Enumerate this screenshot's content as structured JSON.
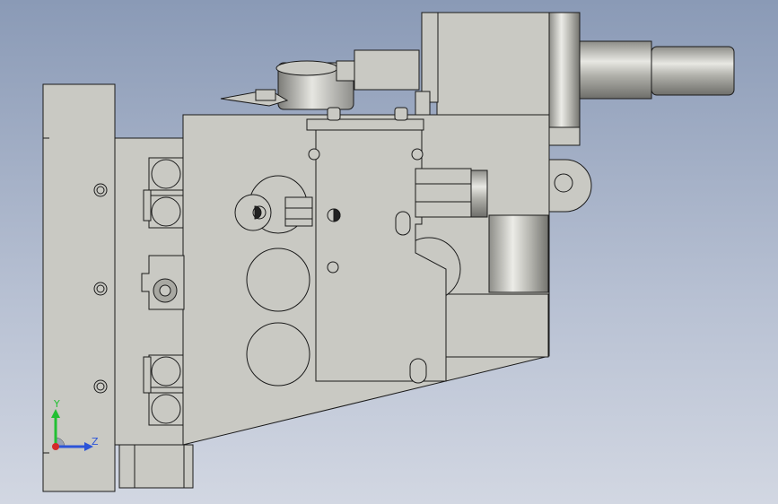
{
  "viewport": {
    "background_top": "#8a9ab6",
    "background_bottom": "#d2d7e2",
    "model_color": "#c9c9c3",
    "model_shadow": "#a8a8a2",
    "edge_color": "#1a1a1a"
  },
  "triad": {
    "y_label": "Y",
    "z_label": "Z",
    "y_color": "#22c033",
    "z_color": "#2c54d8",
    "x_color": "#d42a2a"
  }
}
